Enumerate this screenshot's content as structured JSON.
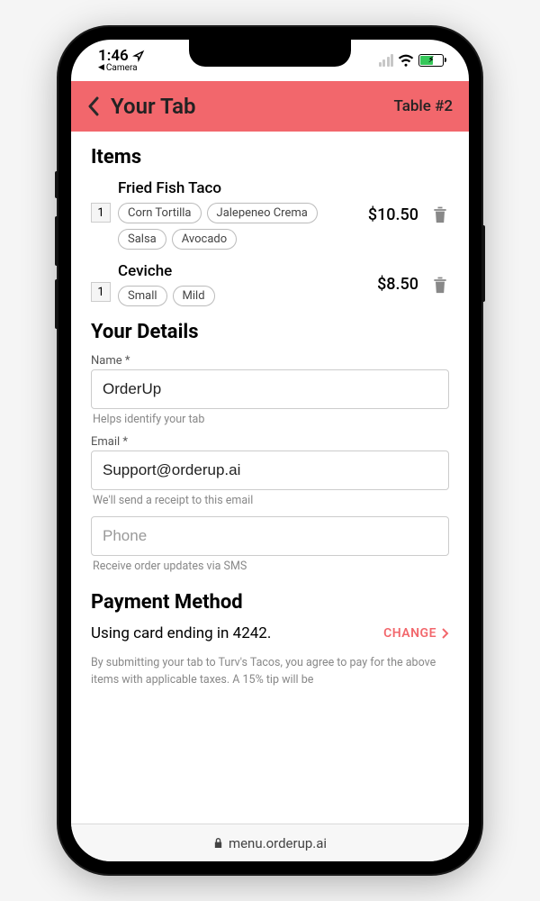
{
  "status": {
    "time": "1:46",
    "camera_back": "Camera"
  },
  "header": {
    "title": "Your Tab",
    "table": "Table #2"
  },
  "items_section": {
    "title": "Items",
    "items": [
      {
        "qty": "1",
        "name": "Fried Fish Taco",
        "mods": [
          "Corn Tortilla",
          "Jalepeneo Crema",
          "Salsa",
          "Avocado"
        ],
        "price": "$10.50"
      },
      {
        "qty": "1",
        "name": "Ceviche",
        "mods": [
          "Small",
          "Mild"
        ],
        "price": "$8.50"
      }
    ]
  },
  "details": {
    "title": "Your Details",
    "name_label": "Name *",
    "name_value": "OrderUp",
    "name_helper": "Helps identify your tab",
    "email_label": "Email *",
    "email_value": "Support@orderup.ai",
    "email_helper": "We'll send a receipt to this email",
    "phone_placeholder": "Phone",
    "phone_helper": "Receive order updates via SMS"
  },
  "payment": {
    "title": "Payment Method",
    "text": "Using card ending in 4242.",
    "change": "CHANGE",
    "legal": "By submitting your tab to Turv's Tacos, you agree to pay for the above items with applicable taxes. A 15% tip will be"
  },
  "browser": {
    "url": "menu.orderup.ai"
  }
}
